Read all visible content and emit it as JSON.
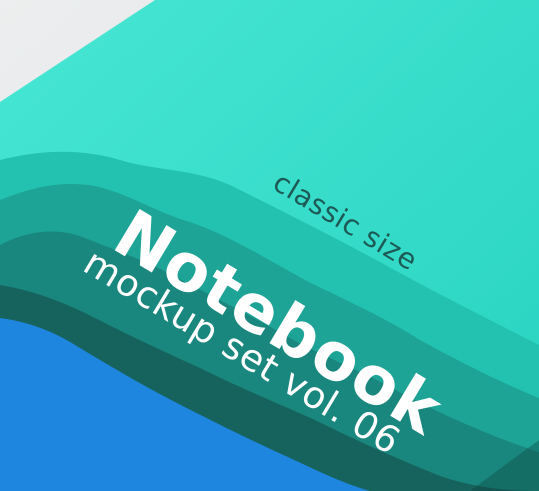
{
  "cover": {
    "title": "Notebook",
    "subtitle": "mockup set vol. 06",
    "size_label": "classic size"
  },
  "colors": {
    "background": "#e6e8e9",
    "cover_teal": "#2ed9c6",
    "cover_teal_light": "#43e4d2",
    "mountain_1": "#23bfae",
    "mountain_2": "#1b9d90",
    "mountain_3": "#187f76",
    "mountain_4": "#155f59",
    "water_blue": "#1f86e0",
    "title_text": "#ffffff",
    "subtitle_text": "#ffffff",
    "size_label_text": "#1d5a55"
  }
}
